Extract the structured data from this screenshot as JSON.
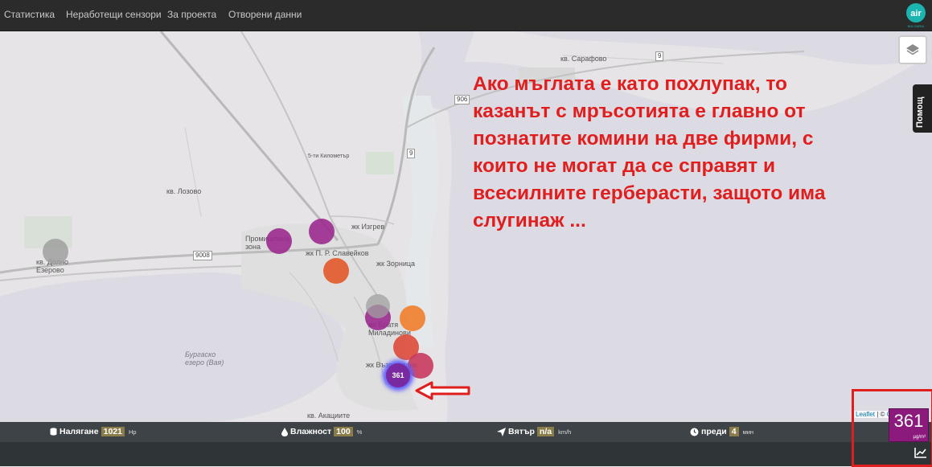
{
  "nav": {
    "items": [
      {
        "label": "Статистика"
      },
      {
        "label": "Неработещи сензори"
      },
      {
        "label": "За проекта"
      },
      {
        "label": "Отворени данни"
      }
    ],
    "brand_text": "air",
    "brand_sub": "BULGARIA"
  },
  "map": {
    "labels": {
      "sarafovo": "кв. Сарафово",
      "lozovo": "кв. Лозово",
      "izgrev": "жк Изгрев",
      "slaveikov": "жк П. Р. Славейков",
      "zornitsa": "жк Зорница",
      "prom_zona": "Промишлена зона",
      "dolno_ezerovo": "кв. Долно Езерово",
      "bratya": "жк Братя Миладинови",
      "vazrazhdane": "жк Възраждане",
      "akatsiite": "кв. Акациите",
      "lake": "Бургаско езеро (Вая)",
      "km5": "5-ти Километър"
    },
    "roads": {
      "r906": "906",
      "r9a": "9",
      "r9b": "9",
      "r9008": "9008"
    },
    "selected_marker_value": "361",
    "marker_colors": {
      "gray": "#a0a0a0",
      "purple": "#9b2a8f",
      "red_orange": "#e2582a",
      "orange": "#f07e2a",
      "red": "#dd4a3a",
      "crimson": "#c9395d"
    }
  },
  "annotation": {
    "lines": [
      "Ако мъглата е като похлупак, то",
      "казанът с мръсотията е главно от",
      "познатите комини на две фирми, с",
      "които не могат да се справят и",
      "всесилните герберасти, защото има",
      "слугинаж ..."
    ]
  },
  "help_tab": {
    "label": "Помощ"
  },
  "attribution": {
    "leaflet": "Leaflet",
    "sep": " | © ",
    "rest": "O"
  },
  "status": {
    "pressure": {
      "label": "Налягане",
      "value": "1021",
      "unit": "Hp"
    },
    "humidity": {
      "label": "Влажност",
      "value": "100",
      "unit": "%"
    },
    "wind": {
      "label": "Вятър",
      "value": "n/a",
      "unit": "km/h"
    },
    "time": {
      "label": "преди",
      "value": "4",
      "unit": "мин"
    }
  },
  "aqi": {
    "value": "361",
    "unit": "µg/m³"
  }
}
